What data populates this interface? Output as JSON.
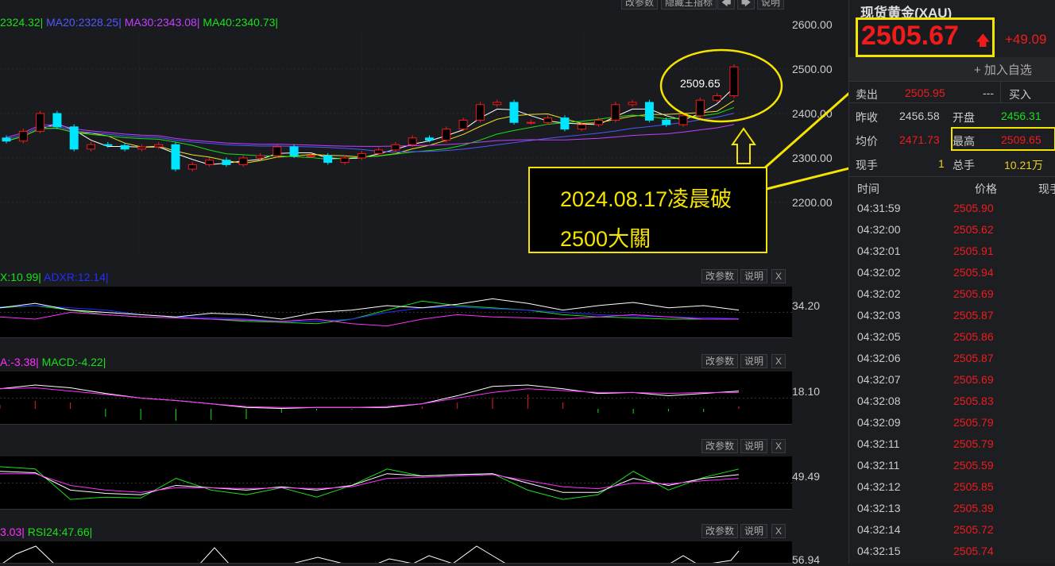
{
  "toolbar": {
    "params": "改参数",
    "hide_main": "隐藏主指标",
    "prev": "🡄",
    "next": "🡆",
    "explain": "说明"
  },
  "ma": {
    "ma10": "2324.32|",
    "ma20": "MA20:2328.25|",
    "ma30": "MA30:2343.08|",
    "ma40": "MA40:2340.73|"
  },
  "axis": {
    "main": [
      "2600.00",
      "2500.00",
      "2400.00",
      "2300.00",
      "2200.00"
    ],
    "adx": "34.20",
    "macd": "18.10",
    "kdj": "49.49",
    "rsi": "56.94"
  },
  "panels": {
    "adx": {
      "l1": "X:10.99|",
      "l2": "ADXR:12.14|"
    },
    "macd": {
      "l1": "A:-3.38|",
      "l2": "MACD:-4.22|"
    },
    "rsi": {
      "l1": "3.03|",
      "l2": "RSI24:47.66|"
    },
    "btn_params": "改参数",
    "btn_explain": "说明",
    "btn_close": "X"
  },
  "chart_data": {
    "type": "candlestick",
    "price_range": [
      2160,
      2620
    ],
    "closes": [
      2338,
      2360,
      2400,
      2370,
      2320,
      2330,
      2328,
      2320,
      2325,
      2330,
      2275,
      2285,
      2295,
      2285,
      2300,
      2305,
      2325,
      2305,
      2305,
      2290,
      2300,
      2310,
      2318,
      2330,
      2345,
      2340,
      2365,
      2385,
      2420,
      2425,
      2380,
      2380,
      2390,
      2365,
      2375,
      2385,
      2420,
      2425,
      2385,
      2375,
      2395,
      2430,
      2440,
      2505
    ],
    "first_open": 2345,
    "adx": {
      "white": [
        60,
        70,
        55,
        50,
        45,
        40,
        48,
        45,
        35,
        50,
        55,
        65,
        60,
        68,
        80,
        70,
        55,
        65,
        72,
        60,
        65,
        55
      ],
      "green": [
        60,
        65,
        55,
        45,
        40,
        38,
        35,
        30,
        28,
        25,
        35,
        55,
        75,
        65,
        60,
        55,
        45,
        40,
        38,
        35,
        35,
        35
      ],
      "blue": [
        62,
        65,
        60,
        55,
        45,
        40,
        38,
        35,
        30,
        30,
        35,
        50,
        60,
        62,
        58,
        55,
        50,
        45,
        42,
        40,
        38,
        36
      ],
      "magenta": [
        40,
        35,
        50,
        45,
        40,
        38,
        35,
        33,
        30,
        35,
        25,
        20,
        35,
        45,
        40,
        38,
        35,
        40,
        45,
        40,
        35,
        35
      ]
    },
    "macd": {
      "white": [
        70,
        78,
        72,
        60,
        50,
        45,
        38,
        30,
        28,
        30,
        30,
        30,
        38,
        55,
        75,
        78,
        70,
        60,
        62,
        55,
        60,
        65
      ],
      "magenta": [
        70,
        72,
        65,
        58,
        50,
        45,
        38,
        32,
        30,
        30,
        30,
        32,
        38,
        50,
        62,
        70,
        66,
        62,
        62,
        60,
        62,
        62
      ],
      "hist": [
        5,
        10,
        8,
        -10,
        -14,
        -15,
        -14,
        -13,
        -5,
        -2,
        -1,
        0,
        3,
        8,
        14,
        18,
        8,
        -5,
        -6,
        -3,
        -4,
        3
      ]
    },
    "kdj": {
      "green": [
        85,
        80,
        15,
        20,
        18,
        60,
        35,
        25,
        40,
        20,
        45,
        80,
        65,
        68,
        70,
        35,
        15,
        25,
        75,
        35,
        62,
        80
      ],
      "white": [
        75,
        72,
        35,
        28,
        25,
        45,
        40,
        35,
        42,
        35,
        45,
        70,
        65,
        68,
        70,
        50,
        30,
        30,
        60,
        45,
        60,
        68
      ],
      "magenta": [
        70,
        70,
        45,
        35,
        30,
        40,
        40,
        38,
        40,
        38,
        42,
        60,
        62,
        65,
        68,
        55,
        42,
        38,
        50,
        48,
        55,
        60
      ]
    }
  },
  "annotation": {
    "high_label": "2509.65",
    "text1": "2024.08.17凌晨破",
    "text2": "2500大關"
  },
  "quote": {
    "title": "现货黄金(XAU)",
    "price": "2505.67",
    "arrow": "🡅",
    "change": "+49.09",
    "add_watch": "+ 加入自选",
    "sell_label": "卖出",
    "sell": "2505.95",
    "dash": "---",
    "buy_label": "买入",
    "prev_close_label": "昨收",
    "prev_close": "2456.58",
    "open_label": "开盘",
    "open": "2456.31",
    "avg_label": "均价",
    "avg": "2471.73",
    "high_label": "最高",
    "high": "2509.65",
    "cur_vol_label": "现手",
    "cur_vol": "1",
    "total_vol_label": "总手",
    "total_vol": "10.21万",
    "col_time": "时间",
    "col_price": "价格",
    "col_vol": "现手"
  },
  "ticks": [
    [
      "04:31:59",
      "2505.90"
    ],
    [
      "04:32:00",
      "2505.62"
    ],
    [
      "04:32:01",
      "2505.91"
    ],
    [
      "04:32:02",
      "2505.94"
    ],
    [
      "04:32:02",
      "2505.69"
    ],
    [
      "04:32:03",
      "2505.87"
    ],
    [
      "04:32:05",
      "2505.86"
    ],
    [
      "04:32:06",
      "2505.87"
    ],
    [
      "04:32:07",
      "2505.69"
    ],
    [
      "04:32:08",
      "2505.83"
    ],
    [
      "04:32:09",
      "2505.79"
    ],
    [
      "04:32:11",
      "2505.79"
    ],
    [
      "04:32:11",
      "2505.59"
    ],
    [
      "04:32:12",
      "2505.85"
    ],
    [
      "04:32:13",
      "2505.39"
    ],
    [
      "04:32:14",
      "2505.72"
    ],
    [
      "04:32:15",
      "2505.74"
    ]
  ]
}
